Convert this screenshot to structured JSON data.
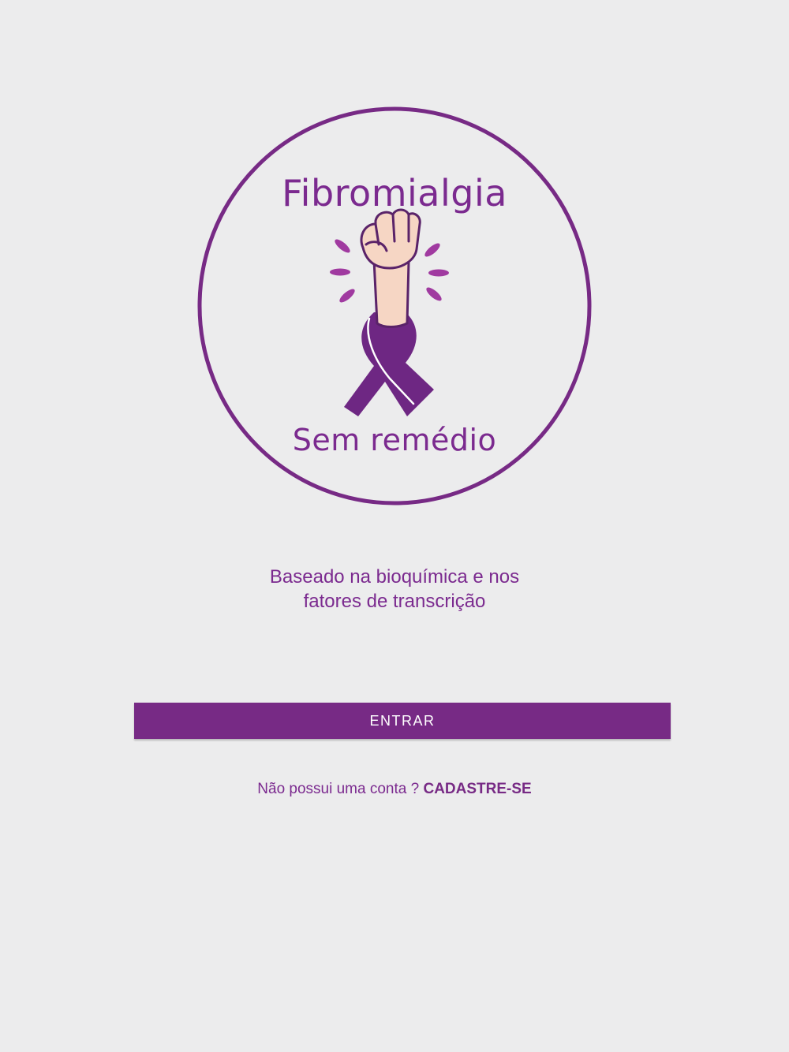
{
  "logo": {
    "title": "Fibromialgia",
    "subtitle": "Sem remédio"
  },
  "tagline": {
    "line1": "Baseado na bioquímica e nos",
    "line2": "fatores de transcrição"
  },
  "login": {
    "enter_label": "ENTRAR"
  },
  "signup": {
    "prompt": "Não possui uma conta ? ",
    "link_label": "CADASTRE-SE"
  },
  "colors": {
    "background": "#ececed",
    "primary_purple": "#772a85",
    "text_purple": "#7b2a8f",
    "ribbon_purple": "#6e2783",
    "accent_magenta": "#a03aa0",
    "skin": "#f6d6c4",
    "button_text": "#ffffff"
  },
  "icons": {
    "fist": "raised-fist-icon",
    "ribbon": "awareness-ribbon-icon"
  }
}
